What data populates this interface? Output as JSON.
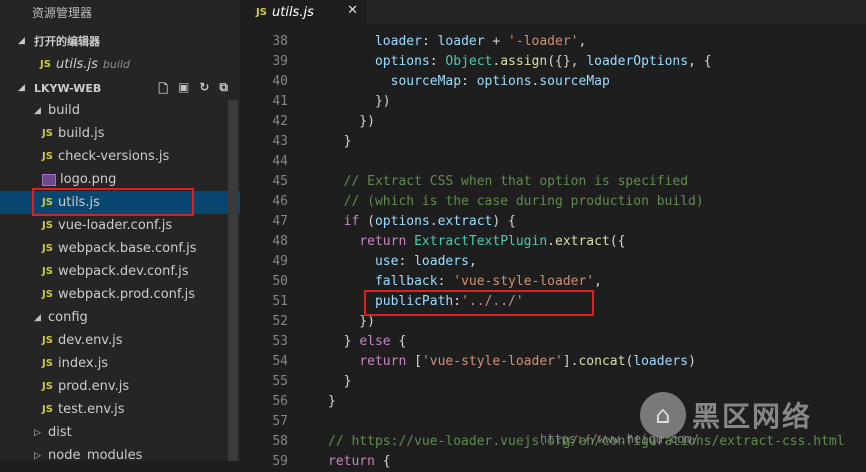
{
  "sidebar": {
    "title": "资源管理器",
    "open_editors": {
      "label": "打开的编辑器",
      "file": "utils.js",
      "file_dir": "build"
    },
    "project": {
      "label": "LKYW-WEB",
      "actions": [
        "new-file-icon",
        "new-folder-icon",
        "refresh-icon",
        "collapse-icon"
      ]
    },
    "tree": [
      {
        "kind": "folder",
        "label": "build",
        "depth": 1,
        "open": true
      },
      {
        "kind": "js",
        "label": "build.js",
        "depth": 2
      },
      {
        "kind": "js",
        "label": "check-versions.js",
        "depth": 2
      },
      {
        "kind": "img",
        "label": "logo.png",
        "depth": 2
      },
      {
        "kind": "js",
        "label": "utils.js",
        "depth": 2,
        "selected": true
      },
      {
        "kind": "js",
        "label": "vue-loader.conf.js",
        "depth": 2
      },
      {
        "kind": "js",
        "label": "webpack.base.conf.js",
        "depth": 2
      },
      {
        "kind": "js",
        "label": "webpack.dev.conf.js",
        "depth": 2
      },
      {
        "kind": "js",
        "label": "webpack.prod.conf.js",
        "depth": 2
      },
      {
        "kind": "folder",
        "label": "config",
        "depth": 1,
        "open": true
      },
      {
        "kind": "js",
        "label": "dev.env.js",
        "depth": 2
      },
      {
        "kind": "js",
        "label": "index.js",
        "depth": 2
      },
      {
        "kind": "js",
        "label": "prod.env.js",
        "depth": 2
      },
      {
        "kind": "js",
        "label": "test.env.js",
        "depth": 2
      },
      {
        "kind": "folder",
        "label": "dist",
        "depth": 1,
        "open": false
      },
      {
        "kind": "folder",
        "label": "node_modules",
        "depth": 1,
        "open": false
      }
    ]
  },
  "tab": {
    "icon": "JS",
    "label": "utils.js",
    "close": "✕"
  },
  "editor": {
    "lines": [
      {
        "n": "38",
        "text": "      loader: loader + '-loader',"
      },
      {
        "n": "39",
        "text": "      options: Object.assign({}, loaderOptions, {"
      },
      {
        "n": "40",
        "text": "        sourceMap: options.sourceMap"
      },
      {
        "n": "41",
        "text": "      })"
      },
      {
        "n": "42",
        "text": "    })"
      },
      {
        "n": "43",
        "text": "  }"
      },
      {
        "n": "44",
        "text": ""
      },
      {
        "n": "45",
        "text": "  // Extract CSS when that option is specified"
      },
      {
        "n": "46",
        "text": "  // (which is the case during production build)"
      },
      {
        "n": "47",
        "text": "  if (options.extract) {"
      },
      {
        "n": "48",
        "text": "    return ExtractTextPlugin.extract({"
      },
      {
        "n": "49",
        "text": "      use: loaders,"
      },
      {
        "n": "50",
        "text": "      fallback: 'vue-style-loader',"
      },
      {
        "n": "51",
        "text": "      publicPath:'../../'"
      },
      {
        "n": "52",
        "text": "    })"
      },
      {
        "n": "53",
        "text": "  } else {"
      },
      {
        "n": "54",
        "text": "    return ['vue-style-loader'].concat(loaders)"
      },
      {
        "n": "55",
        "text": "  }"
      },
      {
        "n": "56",
        "text": "}"
      },
      {
        "n": "57",
        "text": ""
      },
      {
        "n": "58",
        "text": "// https://vue-loader.vuejs.org/en/configurations/extract-css.html"
      },
      {
        "n": "59",
        "text": "return {"
      }
    ]
  },
  "watermark": {
    "text": "黑区网络",
    "url": "https://www.heiqu.com/"
  },
  "colors": {
    "highlight_box": "#e02020",
    "selection": "#094771",
    "js_badge": "#cbcb41"
  }
}
